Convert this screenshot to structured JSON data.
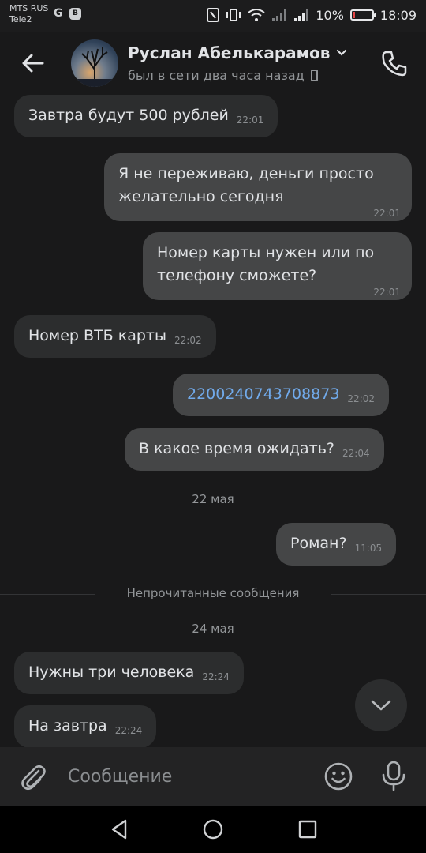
{
  "status_bar": {
    "carrier1": "MTS RUS",
    "carrier2": "Tele2",
    "battery": "10%",
    "time": "18:09"
  },
  "header": {
    "name": "Руслан Абелькарамов",
    "status": "был в сети два часа назад"
  },
  "messages": [
    {
      "dir": "in",
      "text": "Завтра будут 500 рублей",
      "time": "22:01"
    },
    {
      "dir": "out",
      "text": "Я не переживаю, деньги просто желательно сегодня",
      "time": "22:01"
    },
    {
      "dir": "out",
      "text": "Номер карты нужен или по телефону сможете?",
      "time": "22:01"
    },
    {
      "dir": "in",
      "text": "Номер ВТБ карты",
      "time": "22:02"
    },
    {
      "dir": "out",
      "text": "2200240743708873",
      "time": "22:02"
    },
    {
      "dir": "out",
      "text": "В какое время ожидать?",
      "time": "22:04"
    },
    {
      "dir": "out",
      "text": "Роман?",
      "time": "11:05"
    },
    {
      "dir": "in",
      "text": "Нужны три человека",
      "time": "22:24"
    },
    {
      "dir": "in",
      "text": "На завтра",
      "time": "22:24"
    }
  ],
  "dates": [
    "22 мая",
    "24 мая"
  ],
  "unread_label": "Непрочитанные сообщения",
  "composer": {
    "placeholder": "Сообщение"
  },
  "colors": {
    "background": "#19191a",
    "bubble_in": "#2c2d2e",
    "bubble_out": "#454647",
    "link": "#71aaeb"
  },
  "icons": [
    "back-arrow-icon",
    "chevron-down-icon",
    "phone-call-icon",
    "paperclip-icon",
    "emoji-icon",
    "microphone-icon",
    "chevron-down-icon",
    "nav-back-icon",
    "nav-home-icon",
    "nav-recents-icon"
  ]
}
